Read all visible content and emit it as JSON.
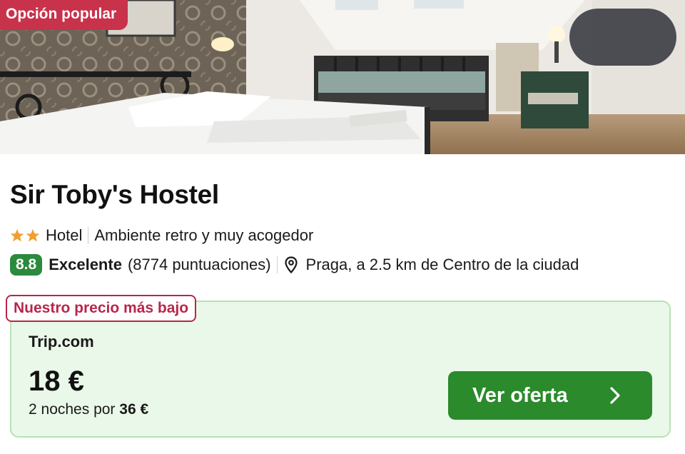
{
  "hero": {
    "badge": "Opción popular",
    "share_icon": "share-icon",
    "favorite_icon": "heart-icon"
  },
  "hotel": {
    "name": "Sir Toby's Hostel",
    "stars": 2,
    "type": "Hotel",
    "tagline": "Ambiente retro y muy acogedor",
    "score": "8.8",
    "rating_label": "Excelente",
    "reviews": "(8774 puntuaciones)",
    "location": "Praga, a 2.5 km de Centro de la ciudad"
  },
  "offer": {
    "tag": "Nuestro precio más bajo",
    "provider": "Trip.com",
    "price": "18 €",
    "nights_text": "2 noches por",
    "total": "36 €",
    "cta_label": "Ver oferta"
  },
  "colors": {
    "badge": "#c8324b",
    "score": "#2b8a3e",
    "cta": "#2b8a2c",
    "card_bg": "#eaf8e9",
    "star": "#f0a030"
  }
}
